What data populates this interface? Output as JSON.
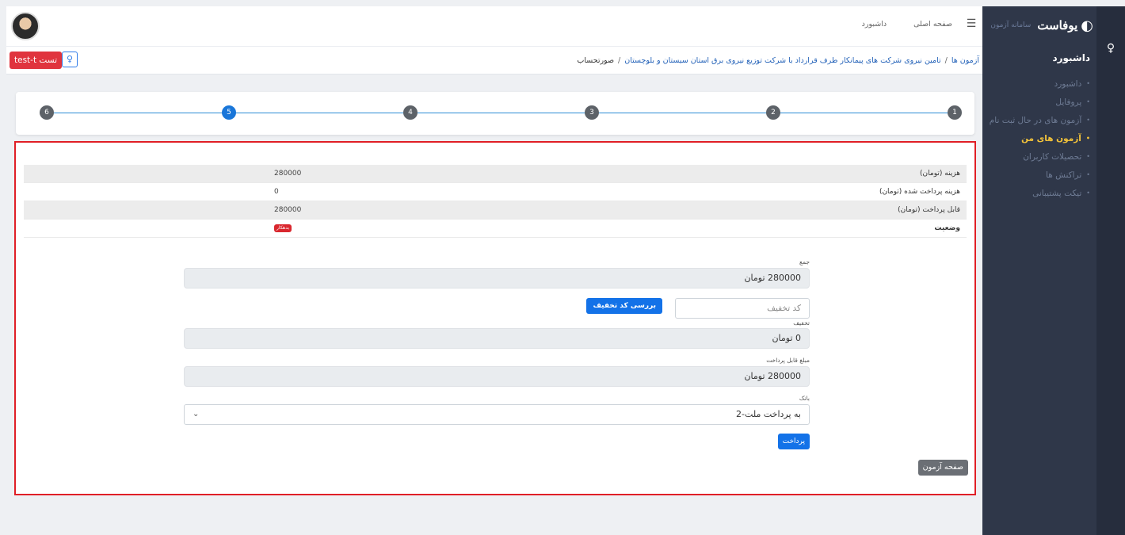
{
  "brand": {
    "logo": "◐",
    "name": "یوفاست",
    "sub": "سامانه آزمون"
  },
  "sidebar": {
    "title": "داشبورد",
    "items": [
      {
        "label": "داشبورد",
        "active": false
      },
      {
        "label": "پروفایل",
        "active": false
      },
      {
        "label": "آزمون های در حال ثبت نام",
        "active": false
      },
      {
        "label": "آزمون های من",
        "active": true
      },
      {
        "label": "تحصیلات کاربران",
        "active": false
      },
      {
        "label": "تراکنش ها",
        "active": false
      },
      {
        "label": "تیکت پشتیبانی",
        "active": false
      }
    ]
  },
  "topnav": {
    "home": "صفحه اصلی",
    "dashboard": "داشبورد"
  },
  "breadcrumb": {
    "item1": "آزمون ها",
    "item2": "تامین نیروی شرکت های پیمانکار طرف قرارداد با شرکت توزیع نیروی برق استان سیستان و بلوچستان",
    "current": "صورتحساب",
    "sep": "/"
  },
  "user": {
    "label": "test-t تست"
  },
  "stepper": {
    "steps": [
      "1",
      "2",
      "3",
      "4",
      "5",
      "6"
    ],
    "active": "5"
  },
  "invoice": {
    "rows": [
      {
        "label": "هزینه (تومان)",
        "value": "280000"
      },
      {
        "label": "هزینه پرداخت شده (تومان)",
        "value": "0"
      },
      {
        "label": "قابل پرداخت (تومان)",
        "value": "280000"
      }
    ],
    "status_label": "وضعیت",
    "status_badge": "بدهکار"
  },
  "form": {
    "total_label": "جمع",
    "total_value": "280000 تومان",
    "discount_placeholder": "کد تخفیف",
    "discount_button": "بررسی کد تخفیف",
    "discount_label": "تخفیف",
    "discount_value": "0 تومان",
    "payable_label": "مبلغ قابل پرداخت",
    "payable_value": "280000 تومان",
    "bank_label": "بانک",
    "bank_value": "به پرداخت ملت-2",
    "pay_button": "پرداخت"
  },
  "exam_page_button": "صفحه آزمون",
  "colors": {
    "sidebar": "#2f3749",
    "accent": "#1372e8",
    "danger": "#e0343e",
    "active_menu": "#f3c33a"
  }
}
